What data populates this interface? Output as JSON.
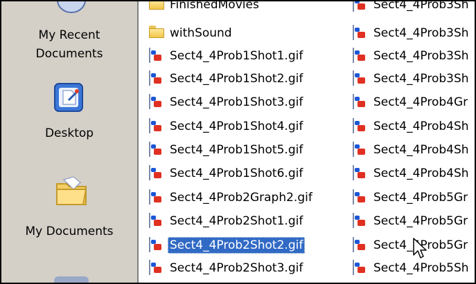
{
  "places": [
    {
      "name": "place-my-recent-documents",
      "label_line1": "My Recent",
      "label_line2": "Documents"
    },
    {
      "name": "place-desktop",
      "label": "Desktop"
    },
    {
      "name": "place-my-documents",
      "label": "My Documents"
    }
  ],
  "files_col1": [
    {
      "name": "FinishedMovies",
      "type": "folder"
    },
    {
      "name": "withSound",
      "type": "folder"
    },
    {
      "name": "Sect4_4Prob1Shot1.gif",
      "type": "gif"
    },
    {
      "name": "Sect4_4Prob1Shot2.gif",
      "type": "gif"
    },
    {
      "name": "Sect4_4Prob1Shot3.gif",
      "type": "gif"
    },
    {
      "name": "Sect4_4Prob1Shot4.gif",
      "type": "gif"
    },
    {
      "name": "Sect4_4Prob1Shot5.gif",
      "type": "gif"
    },
    {
      "name": "Sect4_4Prob1Shot6.gif",
      "type": "gif"
    },
    {
      "name": "Sect4_4Prob2Graph2.gif",
      "type": "gif"
    },
    {
      "name": "Sect4_4Prob2Shot1.gif",
      "type": "gif"
    },
    {
      "name": "Sect4_4Prob2Shot2.gif",
      "type": "gif",
      "selected": true
    },
    {
      "name": "Sect4_4Prob2Shot3.gif",
      "type": "gif"
    }
  ],
  "files_col2": [
    {
      "name": "Sect4_4Prob3Sh",
      "type": "gif"
    },
    {
      "name": "Sect4_4Prob3Sh",
      "type": "gif"
    },
    {
      "name": "Sect4_4Prob3Sh",
      "type": "gif"
    },
    {
      "name": "Sect4_4Prob3Sh",
      "type": "gif"
    },
    {
      "name": "Sect4_4Prob4Gr",
      "type": "gif"
    },
    {
      "name": "Sect4_4Prob4Sh",
      "type": "gif"
    },
    {
      "name": "Sect4_4Prob4Sh",
      "type": "gif"
    },
    {
      "name": "Sect4_4Prob4Sh",
      "type": "gif"
    },
    {
      "name": "Sect4_4Prob5Gr",
      "type": "gif"
    },
    {
      "name": "Sect4_4Prob5Gr",
      "type": "gif"
    },
    {
      "name": "Sect4_4Prob5Gr",
      "type": "gif"
    },
    {
      "name": "Sect4_4Prob5Sh",
      "type": "gif"
    }
  ]
}
